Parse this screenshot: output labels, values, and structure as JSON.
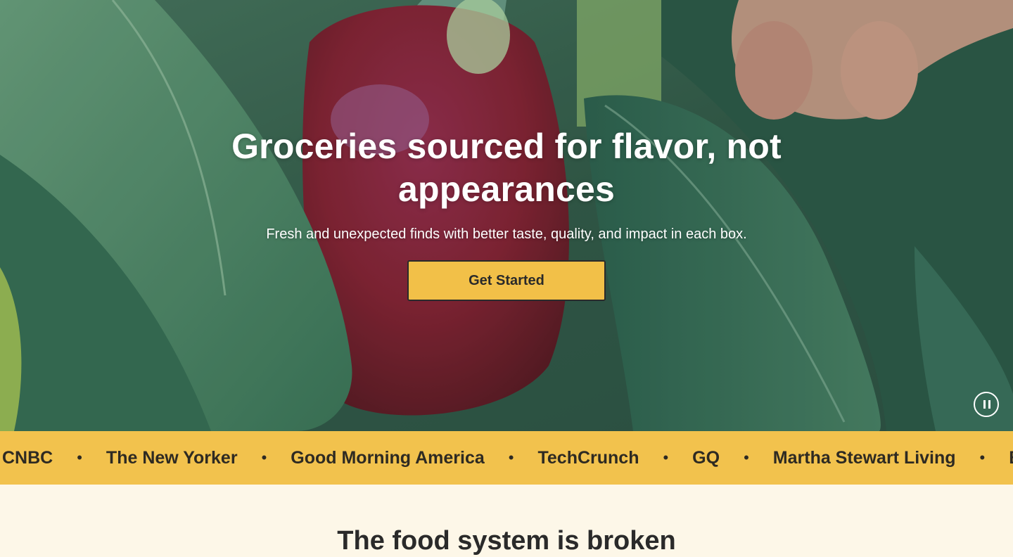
{
  "hero": {
    "title": "Groceries sourced for flavor, not appearances",
    "subtitle": "Fresh and unexpected finds with better taste, quality, and impact in each box.",
    "cta_label": "Get Started",
    "pause_label": "Pause video"
  },
  "press": {
    "items": [
      "CNBC",
      "The New Yorker",
      "Good Morning America",
      "TechCrunch",
      "GQ",
      "Martha Stewart Living",
      "Buzz"
    ],
    "separator": "•"
  },
  "section": {
    "title": "The food system is broken"
  },
  "colors": {
    "accent": "#f2c24d",
    "button": "#f2c048",
    "text_dark": "#2a2a2a",
    "background": "#fdf7e8"
  },
  "icons": {
    "pause": "pause-icon"
  }
}
